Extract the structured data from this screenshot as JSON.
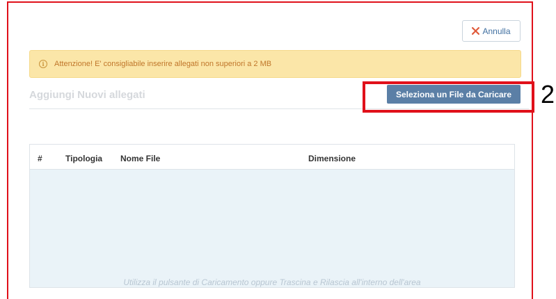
{
  "cancel_button": {
    "label": "Annulla",
    "icon": "close-icon",
    "icon_color": "#e05a3a"
  },
  "alert": {
    "icon": "info-icon",
    "icon_glyph": "i",
    "text": "Attenzione! E' consigliabile inserire allegati non superiori a 2 MB"
  },
  "section": {
    "title": "Aggiungi Nuovi allegati"
  },
  "select_file_button": {
    "label": "Seleziona un File da Caricare"
  },
  "annotation": {
    "step_number": "2",
    "color": "#e0101a"
  },
  "table": {
    "columns": [
      "#",
      "Tipologia",
      "Nome File",
      "Dimensione"
    ],
    "rows": [],
    "drop_hint": "Utilizza il pulsante di Caricamento oppure Trascina e Rilascia all'interno dell'area"
  },
  "colors": {
    "primary_button": "#5b7fa6",
    "alert_background": "#fbe6a8",
    "alert_text": "#c0762a",
    "dropzone_background": "#eaf3f8"
  }
}
